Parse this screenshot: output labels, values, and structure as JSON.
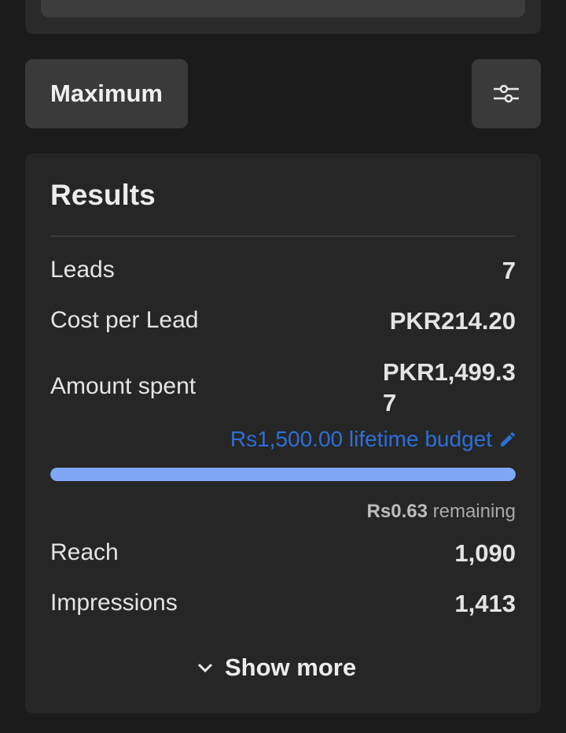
{
  "toolbar": {
    "bid_strategy_label": "Maximum",
    "filter_icon": "sliders-icon"
  },
  "results": {
    "title": "Results",
    "leads": {
      "label": "Leads",
      "value": "7"
    },
    "cost_per_lead": {
      "label": "Cost per Lead",
      "value": "PKR214.20"
    },
    "amount_spent": {
      "label": "Amount spent",
      "value": "PKR1,499.37"
    },
    "budget": {
      "link_text": "Rs1,500.00 lifetime budget",
      "icon": "pencil-icon"
    },
    "progress": {
      "percent_spent": 99.96,
      "fill_color": "#7ea6f4"
    },
    "remaining": {
      "amount": "Rs0.63",
      "label": "remaining"
    },
    "reach": {
      "label": "Reach",
      "value": "1,090"
    },
    "impressions": {
      "label": "Impressions",
      "value": "1,413"
    },
    "show_more_label": "Show more"
  },
  "colors": {
    "background": "#1b1b1c",
    "card": "#262627",
    "link": "#2d6fd6"
  }
}
